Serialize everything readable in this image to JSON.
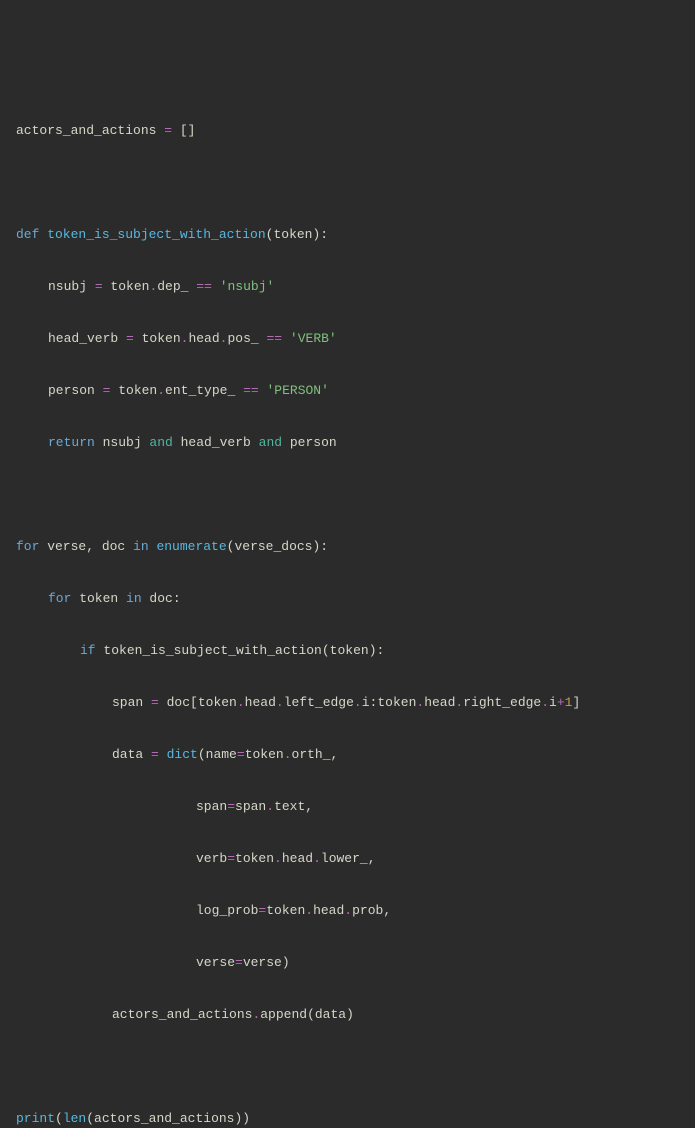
{
  "code": {
    "l1_var": "actors_and_actions",
    "l1_eq": " = ",
    "l1_empty": "[]",
    "l3_def": "def",
    "l3_fn": " token_is_subject_with_action",
    "l3_paren1": "(",
    "l3_param": "token",
    "l3_paren2": "):",
    "l4_var": "nsubj",
    "l4_eq": " = ",
    "l4_tok": "token",
    "l4_dot": ".",
    "l4_dep": "dep_",
    "l4_eqeq": " == ",
    "l4_str": "'nsubj'",
    "l5_var": "head_verb",
    "l5_eq": " = ",
    "l5_tok": "token",
    "l5_dot1": ".",
    "l5_head": "head",
    "l5_dot2": ".",
    "l5_pos": "pos_",
    "l5_eqeq": " == ",
    "l5_str": "'VERB'",
    "l6_var": "person",
    "l6_eq": " = ",
    "l6_tok": "token",
    "l6_dot": ".",
    "l6_ent": "ent_type_",
    "l6_eqeq": " == ",
    "l6_str": "'PERSON'",
    "l7_ret": "return",
    "l7_v1": " nsubj ",
    "l7_and1": "and",
    "l7_v2": " head_verb ",
    "l7_and2": "and",
    "l7_v3": " person",
    "l9_for": "for",
    "l9_v": " verse, doc ",
    "l9_in": "in",
    "l9_enum": " enumerate",
    "l9_p1": "(",
    "l9_vd": "verse_docs",
    "l9_p2": "):",
    "l10_for": "for",
    "l10_tok": " token ",
    "l10_in": "in",
    "l10_doc": " doc:",
    "l11_if": "if",
    "l11_fn": " token_is_subject_with_action",
    "l11_p1": "(",
    "l11_tok": "token",
    "l11_p2": "):",
    "l12_span": "span",
    "l12_eq": " = ",
    "l12_doc": "doc",
    "l12_b1": "[",
    "l12_tok1": "token",
    "l12_d1": ".",
    "l12_head1": "head",
    "l12_d2": ".",
    "l12_le": "left_edge",
    "l12_d3": ".",
    "l12_i1": "i",
    "l12_colon": ":",
    "l12_tok2": "token",
    "l12_d4": ".",
    "l12_head2": "head",
    "l12_d5": ".",
    "l12_re": "right_edge",
    "l12_d6": ".",
    "l12_i2": "i",
    "l12_plus": "+",
    "l12_one": "1",
    "l12_b2": "]",
    "l13_data": "data",
    "l13_eq": " = ",
    "l13_dict": "dict",
    "l13_p1": "(",
    "l13_name": "name",
    "l13_eq2": "=",
    "l13_tok": "token",
    "l13_d": ".",
    "l13_orth": "orth_",
    "l13_comma": ",",
    "l14_span": "span",
    "l14_eq": "=",
    "l14_sp": "span",
    "l14_d": ".",
    "l14_txt": "text",
    "l14_comma": ",",
    "l15_verb": "verb",
    "l15_eq": "=",
    "l15_tok": "token",
    "l15_d1": ".",
    "l15_head": "head",
    "l15_d2": ".",
    "l15_low": "lower_",
    "l15_comma": ",",
    "l16_lp": "log_prob",
    "l16_eq": "=",
    "l16_tok": "token",
    "l16_d1": ".",
    "l16_head": "head",
    "l16_d2": ".",
    "l16_prob": "prob",
    "l16_comma": ",",
    "l17_verse": "verse",
    "l17_eq": "=",
    "l17_v": "verse",
    "l17_p": ")",
    "l18_aa": "actors_and_actions",
    "l18_d": ".",
    "l18_app": "append",
    "l18_p1": "(",
    "l18_data": "data",
    "l18_p2": ")",
    "l20_print": "print",
    "l20_p1": "(",
    "l20_len": "len",
    "l20_p2": "(",
    "l20_aa": "actors_and_actions",
    "l20_p3": "))"
  }
}
